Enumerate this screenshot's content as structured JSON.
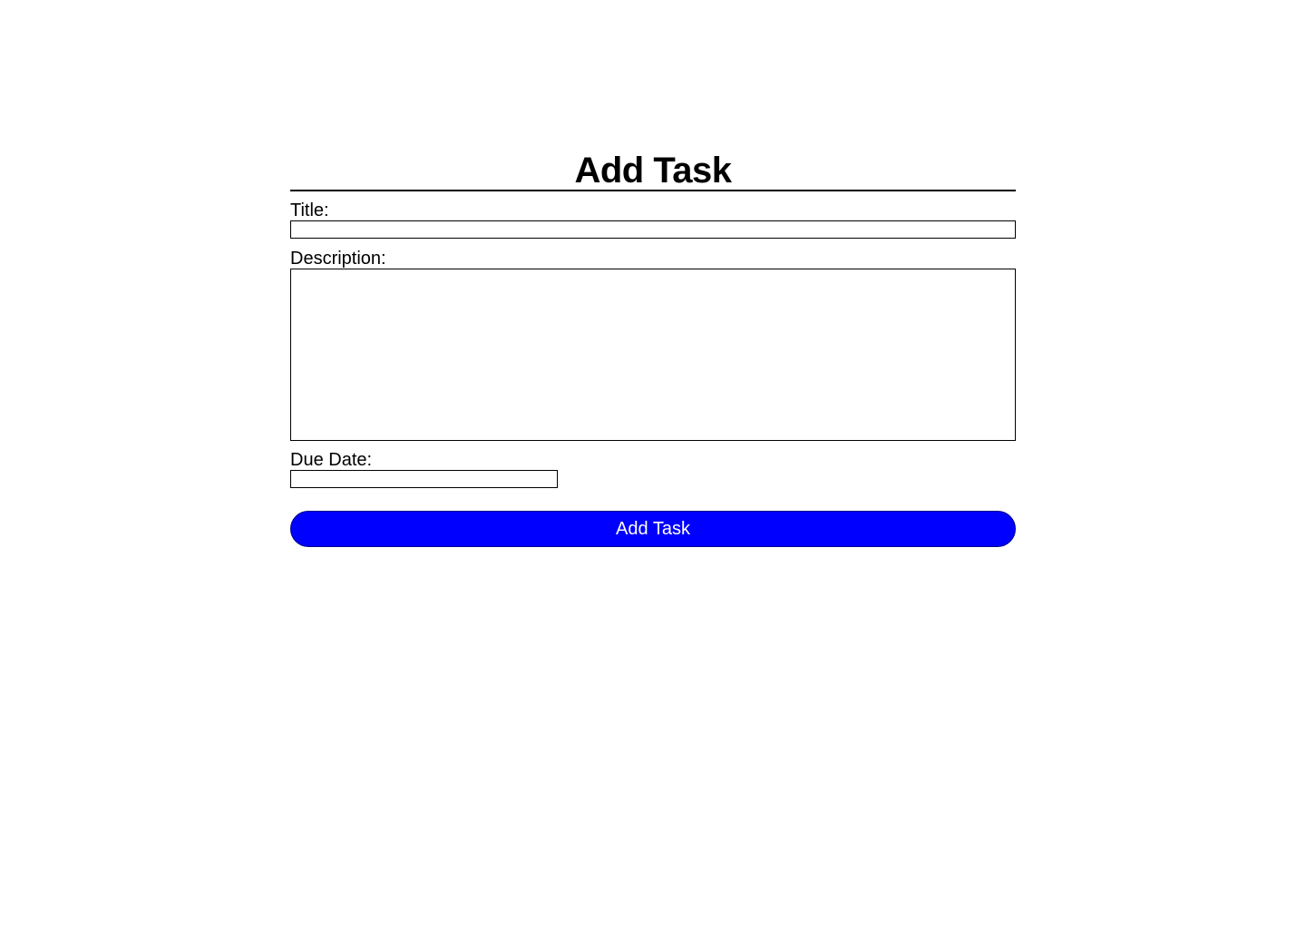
{
  "page": {
    "title": "Add Task"
  },
  "form": {
    "title_label": "Title:",
    "title_value": "",
    "description_label": "Description:",
    "description_value": "",
    "due_date_label": "Due Date:",
    "due_date_value": "",
    "submit_label": "Add Task"
  },
  "colors": {
    "button_background": "#0000ff",
    "button_text": "#ffffff",
    "border": "#000000"
  }
}
